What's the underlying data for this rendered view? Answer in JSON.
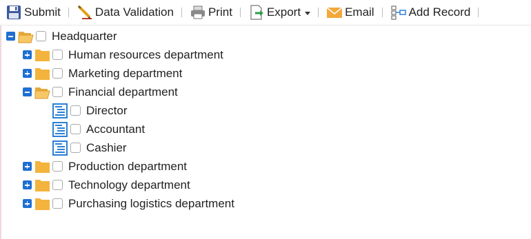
{
  "toolbar": {
    "items": [
      {
        "label": "Submit",
        "icon": "floppy-disk-icon"
      },
      {
        "label": "Data Validation",
        "icon": "pencil-icon"
      },
      {
        "label": "Print",
        "icon": "printer-icon"
      },
      {
        "label": "Export",
        "icon": "export-icon",
        "dropdown": true
      },
      {
        "label": "Email",
        "icon": "envelope-icon"
      },
      {
        "label": "Add Record",
        "icon": "add-record-icon"
      }
    ]
  },
  "tree": {
    "root": {
      "label": "Headquarter",
      "expanded": true
    },
    "departments": [
      {
        "label": "Human resources department",
        "expanded": false
      },
      {
        "label": "Marketing department",
        "expanded": false
      },
      {
        "label": "Financial department",
        "expanded": true,
        "children": [
          {
            "label": "Director"
          },
          {
            "label": "Accountant"
          },
          {
            "label": "Cashier"
          }
        ]
      },
      {
        "label": "Production department",
        "expanded": false
      },
      {
        "label": "Technology department",
        "expanded": false
      },
      {
        "label": "Purchasing logistics department",
        "expanded": false
      }
    ]
  },
  "colors": {
    "expander": "#1f6fd1",
    "folder": "#f4b33c",
    "leaf_icon": "#2a7fd4"
  }
}
